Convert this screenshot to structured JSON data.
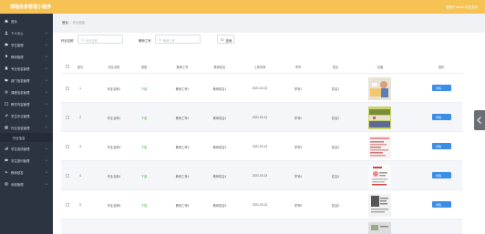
{
  "header": {
    "brand": "课程信息管理小程序",
    "user_text": "管理员 admin 退出登录"
  },
  "sidebar": {
    "items": [
      {
        "label": "首页",
        "icon": "home-icon",
        "has_chevron": false
      },
      {
        "label": "个人中心",
        "icon": "user-icon",
        "has_chevron": true
      },
      {
        "label": "学生管理",
        "icon": "student-icon",
        "has_chevron": true
      },
      {
        "label": "教师管理",
        "icon": "teacher-icon",
        "has_chevron": true
      },
      {
        "label": "专业信息管理",
        "icon": "book-icon",
        "has_chevron": true
      },
      {
        "label": "部门信息管理",
        "icon": "folder-icon",
        "has_chevron": true
      },
      {
        "label": "课程信息管理",
        "icon": "list-icon",
        "has_chevron": true
      },
      {
        "label": "教学内容管理",
        "icon": "doc-icon",
        "has_chevron": true
      },
      {
        "label": "学生作业管理",
        "icon": "edit-icon",
        "has_chevron": true
      },
      {
        "label": "作业信息管理",
        "icon": "grid-icon",
        "has_chevron": true,
        "expanded": true
      },
      {
        "label": "学生成绩管理",
        "icon": "chart-icon",
        "has_chevron": true
      },
      {
        "label": "学生提问管理",
        "icon": "message-icon",
        "has_chevron": true
      },
      {
        "label": "教师回答",
        "icon": "reply-icon",
        "has_chevron": true
      },
      {
        "label": "系统管理",
        "icon": "gear-icon",
        "has_chevron": true
      }
    ],
    "sub_item": "作业信息"
  },
  "breadcrumb": {
    "home": "首页",
    "current": "作业信息"
  },
  "filters": {
    "field1_label": "作业名称",
    "field1_placeholder": "作业名称",
    "field2_label": "教师工号",
    "field2_placeholder": "教师工号",
    "search_button": "查询"
  },
  "table": {
    "headers": [
      "索引",
      "作业名称",
      "类型",
      "教师工号",
      "教师姓名",
      "上传时间",
      "学号",
      "姓名",
      "封面",
      "操作"
    ],
    "rows": [
      {
        "index": "1",
        "name": "作业名称1",
        "type": "下载",
        "teacher_id": "教师工号1",
        "teacher_name": "教师姓名1",
        "date": "2021-03-13",
        "student_id": "学号1",
        "student_name": "姓名1"
      },
      {
        "index": "2",
        "name": "作业名称2",
        "type": "下载",
        "teacher_id": "教师工号2",
        "teacher_name": "教师姓名2",
        "date": "2021-03-13",
        "student_id": "学号2",
        "student_name": "姓名2"
      },
      {
        "index": "3",
        "name": "作业名称3",
        "type": "下载",
        "teacher_id": "教师工号3",
        "teacher_name": "教师姓名3",
        "date": "2021-03-13",
        "student_id": "学号3",
        "student_name": "姓名3"
      },
      {
        "index": "4",
        "name": "作业名称4",
        "type": "下载",
        "teacher_id": "教师工号4",
        "teacher_name": "教师姓名4",
        "date": "2021-03-13",
        "student_id": "学号4",
        "student_name": "姓名4"
      },
      {
        "index": "5",
        "name": "作业名称5",
        "type": "下载",
        "teacher_id": "教师工号5",
        "teacher_name": "教师姓名5",
        "date": "2021-03-13",
        "student_id": "学号5",
        "student_name": "姓名5"
      }
    ],
    "detail_button": "详情"
  },
  "colors": {
    "header_bg": "#f6c254",
    "sidebar_bg": "#2c3441",
    "button_blue": "#3a8ee6",
    "status_green": "#4caf50"
  }
}
